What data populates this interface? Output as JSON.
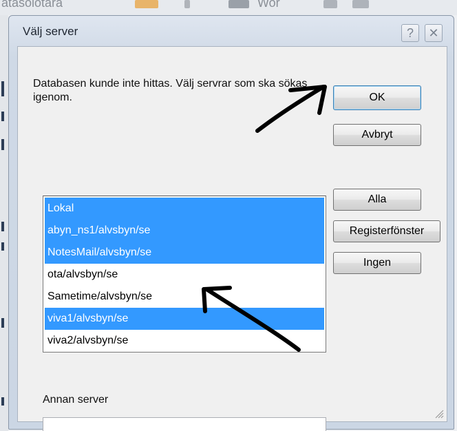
{
  "background": {
    "title_fragment": "atasolotara",
    "fragment_mid": "Wor"
  },
  "dialog": {
    "title": "Välj server",
    "help_glyph": "?",
    "close_glyph": "✕",
    "message": "Databasen  kunde inte hittas. Välj servrar som ska sökas igenom.",
    "buttons": {
      "ok": "OK",
      "cancel": "Avbryt",
      "all": "Alla",
      "directory": "Registerfönster",
      "none": "Ingen"
    },
    "server_list": {
      "items": [
        {
          "label": "Lokal",
          "selected": true
        },
        {
          "label": "abyn_ns1/alvsbyn/se",
          "selected": true
        },
        {
          "label": "NotesMail/alvsbyn/se",
          "selected": true
        },
        {
          "label": "ota/alvsbyn/se",
          "selected": false
        },
        {
          "label": "Sametime/alvsbyn/se",
          "selected": false
        },
        {
          "label": "viva1/alvsbyn/se",
          "selected": true
        },
        {
          "label": "viva2/alvsbyn/se",
          "selected": false
        }
      ]
    },
    "other_server": {
      "label": "Annan server",
      "value": ""
    }
  },
  "colors": {
    "selection": "#3399ff",
    "annotation_arrow": "#000000"
  }
}
